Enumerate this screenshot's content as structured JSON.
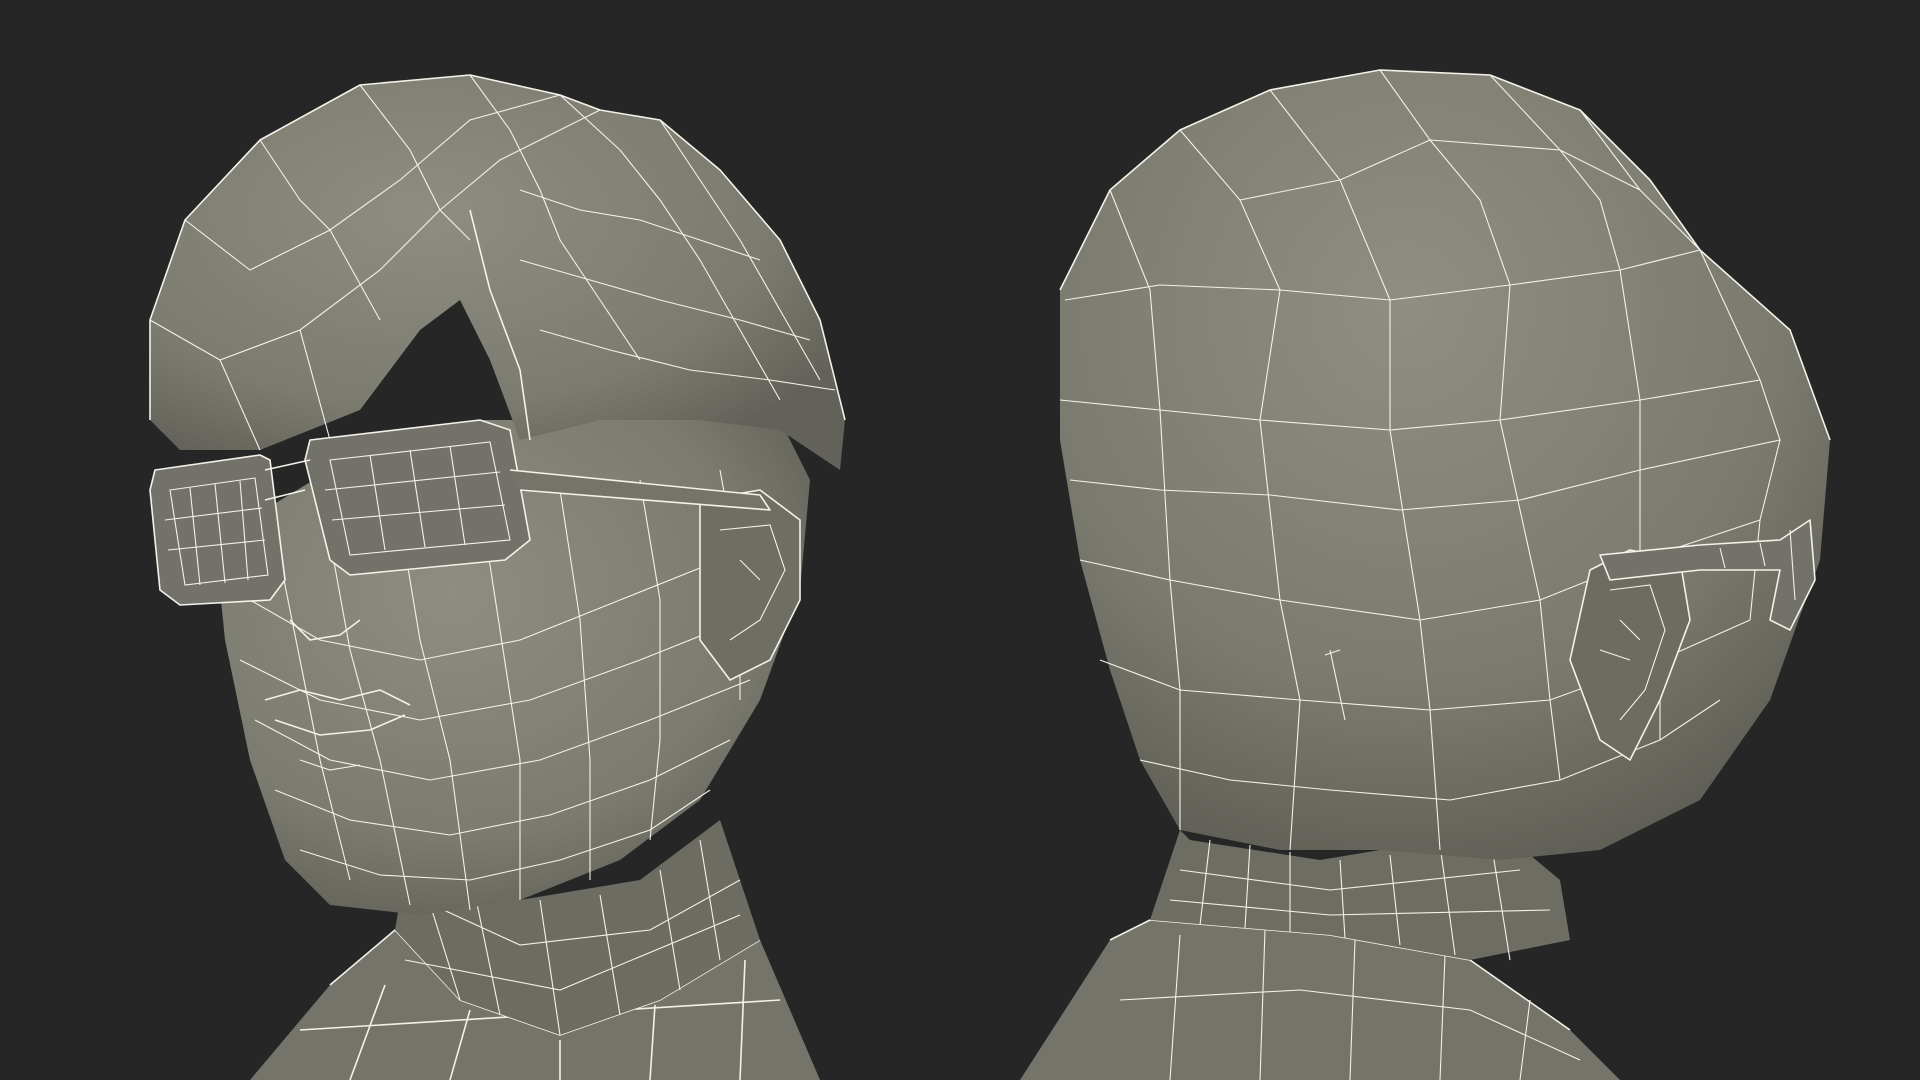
{
  "scene": {
    "background": "#262626",
    "mesh_color": "#7b7b70",
    "mesh_shadow": "#5f5f56",
    "mesh_highlight": "#8d8d82",
    "wireframe_color": "#f4f2e8",
    "views": [
      {
        "id": "front-three-quarter",
        "subject": "head-with-glasses-wireframe"
      },
      {
        "id": "back-three-quarter",
        "subject": "head-back-wireframe"
      }
    ]
  }
}
